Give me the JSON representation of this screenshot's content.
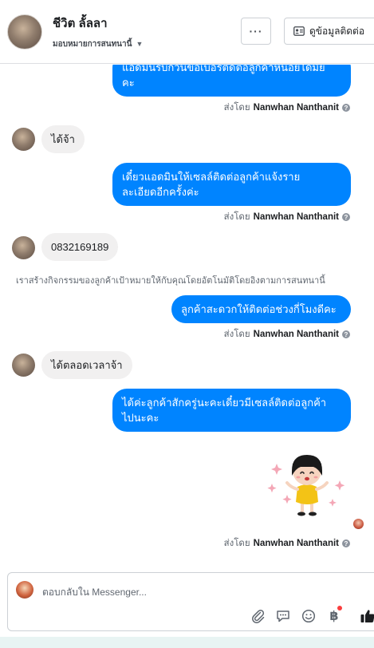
{
  "header": {
    "contact_name": "ชีวิต ลั้ลลา",
    "assign_label": "มอบหมายการสนทนานี้",
    "more_label": "···",
    "info_label": "ดูข้อมูลติดต่อ"
  },
  "messages": [
    {
      "type": "outgoing",
      "lines": [
        "แอดมินรบกวนขอเบอร์ติดต่อลูกค้าหน่อยได้มั้ย",
        "คะ"
      ]
    },
    {
      "type": "sent_by",
      "prefix": "ส่งโดย",
      "sender": "Nanwhan Nanthanit"
    },
    {
      "type": "incoming",
      "text": "ได้จ้า"
    },
    {
      "type": "outgoing",
      "lines": [
        "เดี๋ยวแอดมินให้เซลล์ติดต่อลูกค้าแจ้งราย",
        "ละเอียดอีกครั้งค่ะ"
      ]
    },
    {
      "type": "sent_by",
      "prefix": "ส่งโดย",
      "sender": "Nanwhan Nanthanit"
    },
    {
      "type": "incoming",
      "text": "0832169189"
    },
    {
      "type": "system",
      "text": "เราสร้างกิจกรรมของลูกค้าเป้าหมายให้กับคุณโดยอัตโนมัติโดยอิงตามการสนทนานี้"
    },
    {
      "type": "outgoing",
      "lines": [
        "ลูกค้าสะดวกให้ติดต่อช่วงกี่โมงดีคะ"
      ]
    },
    {
      "type": "sent_by",
      "prefix": "ส่งโดย",
      "sender": "Nanwhan Nanthanit"
    },
    {
      "type": "incoming",
      "text": "ได้ตลอดเวลาจ้า"
    },
    {
      "type": "outgoing",
      "lines": [
        "ได้ค่ะลูกค้าสักครู่นะคะเดี๋ยวมีเซลล์ติดต่อลูกค้า",
        "ไปนะคะ"
      ]
    },
    {
      "type": "sticker",
      "name": "happy-girl-sticker"
    },
    {
      "type": "sent_by",
      "prefix": "ส่งโดย",
      "sender": "Nanwhan Nanthanit"
    }
  ],
  "composer": {
    "placeholder": "ตอบกลับใน Messenger...",
    "tools": [
      "paperclip-icon",
      "chat-bubble-icon",
      "emoji-icon",
      "baht-icon",
      "thumbs-up-icon"
    ]
  },
  "colors": {
    "outgoing_bubble": "#0084ff",
    "incoming_bubble": "#f1f0f0",
    "like_blue": "#1c1e21"
  }
}
